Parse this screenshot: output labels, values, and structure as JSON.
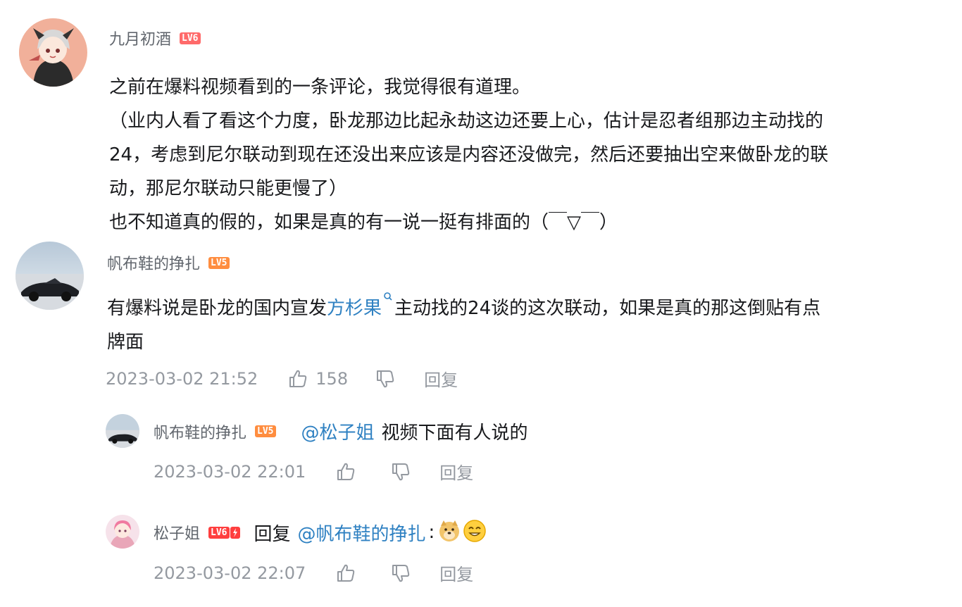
{
  "comments": [
    {
      "user": "九月初酒",
      "level": "LV6",
      "lines": [
        "之前在爆料视频看到的一条评论，我觉得很有道理。",
        "（业内人看了看这个力度，卧龙那边比起永劫这边还要上心，估计是忍者组那边主动找的",
        "24，考虑到尼尔联动到现在还没出来应该是内容还没做完，然后还要抽出空来做卧龙的联",
        "动，那尼尔联动只能更慢了）",
        "也不知道真的假的，如果是真的有一说一挺有排面的（￣▽￣）"
      ]
    },
    {
      "user": "帆布鞋的挣扎",
      "level": "LV5",
      "text_before": "有爆料说是卧龙的国内宣发",
      "link": "方杉果",
      "text_after": "主动找的24谈的这次联动，如果是真的那这倒贴有点",
      "line2": "牌面",
      "time": "2023-03-02 21:52",
      "likes": "158",
      "reply": "回复"
    }
  ],
  "replies": [
    {
      "user": "帆布鞋的挣扎",
      "level": "LV5",
      "mention": "@松子姐",
      "text": "视频下面有人说的",
      "time": "2023-03-02 22:01",
      "reply": "回复"
    },
    {
      "user": "松子姐",
      "level": "LV6",
      "prefix": "回复",
      "mention": "@帆布鞋的挣扎",
      "suffix": ":",
      "time": "2023-03-02 22:07",
      "reply": "回复"
    }
  ],
  "icons": {
    "like": "thumbs-up-icon",
    "dislike": "thumbs-down-icon",
    "search": "search-icon"
  },
  "colors": {
    "link": "#2f81c2",
    "meta": "#9499a0",
    "level6": "#ff6a6a",
    "level5": "#ff8d3f"
  }
}
